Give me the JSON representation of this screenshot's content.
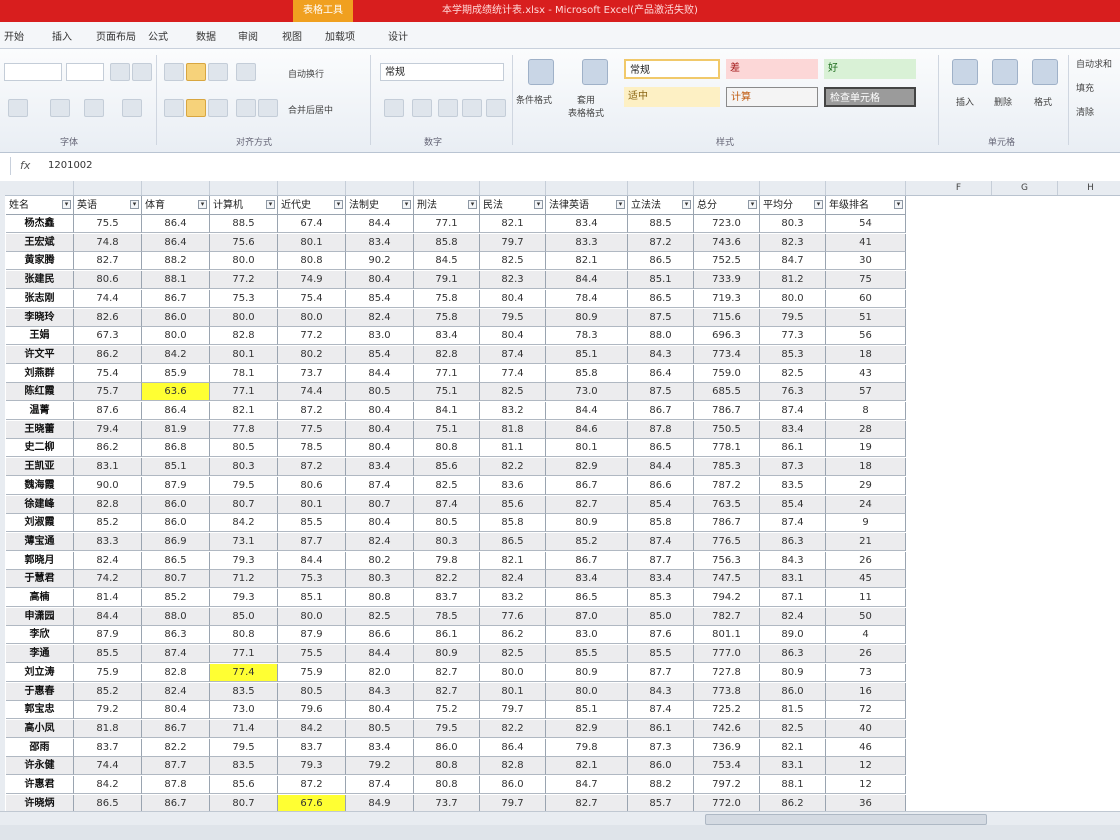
{
  "window": {
    "contextual_tab": "表格工具",
    "title": "本学期成绩统计表.xlsx - Microsoft Excel(产品激活失败)"
  },
  "ribbon_tabs": [
    "开始",
    "插入",
    "页面布局",
    "公式",
    "数据",
    "审阅",
    "视图",
    "加载项",
    "设计"
  ],
  "ribbon": {
    "groups": [
      "字体",
      "对齐方式",
      "数字",
      "样式",
      "单元格"
    ],
    "wrap_text": "自动换行",
    "merge_center": "合并后居中",
    "number_format": "常规",
    "conditional_format": "条件格式",
    "table_format": "套用\n表格格式",
    "styles": {
      "normal": "常规",
      "bad": "差",
      "good": "好",
      "neutral": "适中",
      "calc": "计算",
      "check": "检查单元格"
    },
    "cell_buttons": [
      "插入",
      "删除",
      "格式"
    ],
    "extra": [
      "自动求和",
      "填充",
      "清除"
    ]
  },
  "formula_bar": {
    "fx": "fx",
    "value": "1201002"
  },
  "column_letters": [
    "F",
    "G",
    "H"
  ],
  "table": {
    "headers": [
      "姓名",
      "英语",
      "体育",
      "计算机",
      "近代史",
      "法制史",
      "刑法",
      "民法",
      "法律英语",
      "立法法",
      "总分",
      "平均分",
      "年级排名"
    ],
    "rows": [
      [
        "杨杰鑫",
        "75.5",
        "86.4",
        "88.5",
        "67.4",
        "84.4",
        "77.1",
        "82.1",
        "83.4",
        "88.5",
        "723.0",
        "80.3",
        "54"
      ],
      [
        "王宏斌",
        "74.8",
        "86.4",
        "75.6",
        "80.1",
        "83.4",
        "85.8",
        "79.7",
        "83.3",
        "87.2",
        "743.6",
        "82.3",
        "41"
      ],
      [
        "黄家腾",
        "82.7",
        "88.2",
        "80.0",
        "80.8",
        "90.2",
        "84.5",
        "82.5",
        "82.1",
        "86.5",
        "752.5",
        "84.7",
        "30"
      ],
      [
        "张建民",
        "80.6",
        "88.1",
        "77.2",
        "74.9",
        "80.4",
        "79.1",
        "82.3",
        "84.4",
        "85.1",
        "733.9",
        "81.2",
        "75"
      ],
      [
        "张志刚",
        "74.4",
        "86.7",
        "75.3",
        "75.4",
        "85.4",
        "75.8",
        "80.4",
        "78.4",
        "86.5",
        "719.3",
        "80.0",
        "60"
      ],
      [
        "李晓玲",
        "82.6",
        "86.0",
        "80.0",
        "80.0",
        "82.4",
        "75.8",
        "79.5",
        "80.9",
        "87.5",
        "715.6",
        "79.5",
        "51"
      ],
      [
        "王娟",
        "67.3",
        "80.0",
        "82.8",
        "77.2",
        "83.0",
        "83.4",
        "80.4",
        "78.3",
        "88.0",
        "696.3",
        "77.3",
        "56"
      ],
      [
        "许文平",
        "86.2",
        "84.2",
        "80.1",
        "80.2",
        "85.4",
        "82.8",
        "87.4",
        "85.1",
        "84.3",
        "773.4",
        "85.3",
        "18"
      ],
      [
        "刘燕群",
        "75.4",
        "85.9",
        "78.1",
        "73.7",
        "84.4",
        "77.1",
        "77.4",
        "85.8",
        "86.4",
        "759.0",
        "82.5",
        "43"
      ],
      [
        "陈红霞",
        "75.7",
        "63.6",
        "77.1",
        "74.4",
        "80.5",
        "75.1",
        "82.5",
        "73.0",
        "87.5",
        "685.5",
        "76.3",
        "57"
      ],
      [
        "温菁",
        "87.6",
        "86.4",
        "82.1",
        "87.2",
        "80.4",
        "84.1",
        "83.2",
        "84.4",
        "86.7",
        "786.7",
        "87.4",
        "8"
      ],
      [
        "王晓蕾",
        "79.4",
        "81.9",
        "77.8",
        "77.5",
        "80.4",
        "75.1",
        "81.8",
        "84.6",
        "87.8",
        "750.5",
        "83.4",
        "28"
      ],
      [
        "史二柳",
        "86.2",
        "86.8",
        "80.5",
        "78.5",
        "80.4",
        "80.8",
        "81.1",
        "80.1",
        "86.5",
        "778.1",
        "86.1",
        "19"
      ],
      [
        "王凯亚",
        "83.1",
        "85.1",
        "80.3",
        "87.2",
        "83.4",
        "85.6",
        "82.2",
        "82.9",
        "84.4",
        "785.3",
        "87.3",
        "18"
      ],
      [
        "魏海霞",
        "90.0",
        "87.9",
        "79.5",
        "80.6",
        "87.4",
        "82.5",
        "83.6",
        "86.7",
        "86.6",
        "787.2",
        "83.5",
        "29"
      ],
      [
        "徐建峰",
        "82.8",
        "86.0",
        "80.7",
        "80.1",
        "80.7",
        "87.4",
        "85.6",
        "82.7",
        "85.4",
        "763.5",
        "85.4",
        "24"
      ],
      [
        "刘淑霞",
        "85.2",
        "86.0",
        "84.2",
        "85.5",
        "80.4",
        "80.5",
        "85.8",
        "80.9",
        "85.8",
        "786.7",
        "87.4",
        "9"
      ],
      [
        "薄宝通",
        "83.3",
        "86.9",
        "73.1",
        "87.7",
        "82.4",
        "80.3",
        "86.5",
        "85.2",
        "87.4",
        "776.5",
        "86.3",
        "21"
      ],
      [
        "郭晓月",
        "82.4",
        "86.5",
        "79.3",
        "84.4",
        "80.2",
        "79.8",
        "82.1",
        "86.7",
        "87.7",
        "756.3",
        "84.3",
        "26"
      ],
      [
        "于慧君",
        "74.2",
        "80.7",
        "71.2",
        "75.3",
        "80.3",
        "82.2",
        "82.4",
        "83.4",
        "83.4",
        "747.5",
        "83.1",
        "45"
      ],
      [
        "高楠",
        "81.4",
        "85.2",
        "79.3",
        "85.1",
        "80.8",
        "83.7",
        "83.2",
        "86.5",
        "85.3",
        "794.2",
        "87.1",
        "11"
      ],
      [
        "申潇园",
        "84.4",
        "88.0",
        "85.0",
        "80.0",
        "82.5",
        "78.5",
        "77.6",
        "87.0",
        "85.0",
        "782.7",
        "82.4",
        "50"
      ],
      [
        "李欣",
        "87.9",
        "86.3",
        "80.8",
        "87.9",
        "86.6",
        "86.1",
        "86.2",
        "83.0",
        "87.6",
        "801.1",
        "89.0",
        "4"
      ],
      [
        "李通",
        "85.5",
        "87.4",
        "77.1",
        "75.5",
        "84.4",
        "80.9",
        "82.5",
        "85.5",
        "85.5",
        "777.0",
        "86.3",
        "26"
      ],
      [
        "刘立涛",
        "75.9",
        "82.8",
        "77.4",
        "75.9",
        "82.0",
        "82.7",
        "80.0",
        "80.9",
        "87.7",
        "727.8",
        "80.9",
        "73"
      ],
      [
        "于惠春",
        "85.2",
        "82.4",
        "83.5",
        "80.5",
        "84.3",
        "82.7",
        "80.1",
        "80.0",
        "84.3",
        "773.8",
        "86.0",
        "16"
      ],
      [
        "郭宝忠",
        "79.2",
        "80.4",
        "73.0",
        "79.6",
        "80.4",
        "75.2",
        "79.7",
        "85.1",
        "87.4",
        "725.2",
        "81.5",
        "72"
      ],
      [
        "高小凤",
        "81.8",
        "86.7",
        "71.4",
        "84.2",
        "80.5",
        "79.5",
        "82.2",
        "82.9",
        "86.1",
        "742.6",
        "82.5",
        "40"
      ],
      [
        "邵雨",
        "83.7",
        "82.2",
        "79.5",
        "83.7",
        "83.4",
        "86.0",
        "86.4",
        "79.8",
        "87.3",
        "736.9",
        "82.1",
        "46"
      ],
      [
        "许永健",
        "74.4",
        "87.7",
        "83.5",
        "79.3",
        "79.2",
        "80.8",
        "82.8",
        "82.1",
        "86.0",
        "753.4",
        "83.1",
        "12"
      ],
      [
        "许惠君",
        "84.2",
        "87.8",
        "85.6",
        "87.2",
        "87.4",
        "80.8",
        "86.0",
        "84.7",
        "88.2",
        "797.2",
        "88.1",
        "12"
      ],
      [
        "许晓炳",
        "86.5",
        "86.7",
        "80.7",
        "67.6",
        "84.9",
        "73.7",
        "79.7",
        "82.7",
        "85.7",
        "772.0",
        "86.2",
        "36"
      ]
    ],
    "highlighted": [
      [
        9,
        2
      ],
      [
        24,
        3
      ],
      [
        31,
        4
      ]
    ]
  }
}
